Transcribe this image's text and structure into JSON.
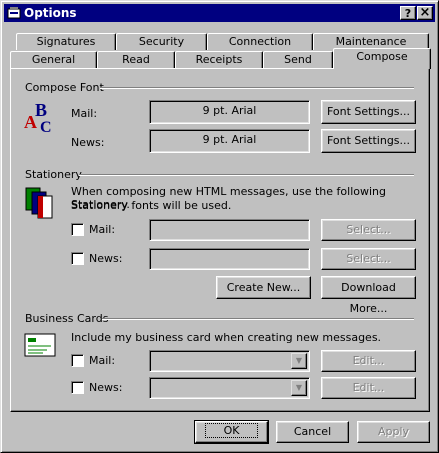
{
  "window": {
    "title": "Options",
    "help_label": "?",
    "close_label": "×"
  },
  "tabs_row_back": [
    "Signatures",
    "Security",
    "Connection",
    "Maintenance"
  ],
  "tabs_row_front": [
    "General",
    "Read",
    "Receipts",
    "Send",
    "Compose"
  ],
  "compose_font": {
    "heading": "Compose Font",
    "mail_label": "Mail:",
    "mail_value": "9 pt. Arial",
    "news_label": "News:",
    "news_value": "9 pt. Arial",
    "font_settings_label": "Font Settings..."
  },
  "stationery": {
    "heading": "Stationery",
    "description_1": "When composing new HTML messages, use the following Stationery.",
    "description_2": "Stationery fonts will be used.",
    "mail_label": "Mail:",
    "news_label": "News:",
    "select_label": "Select...",
    "create_new_label": "Create New...",
    "download_more_label": "Download More..."
  },
  "business_cards": {
    "heading": "Business Cards",
    "description": "Include my business card when creating new messages.",
    "mail_label": "Mail:",
    "news_label": "News:",
    "edit_label": "Edit..."
  },
  "footer": {
    "ok_label": "OK",
    "cancel_label": "Cancel",
    "apply_label": "Apply"
  }
}
